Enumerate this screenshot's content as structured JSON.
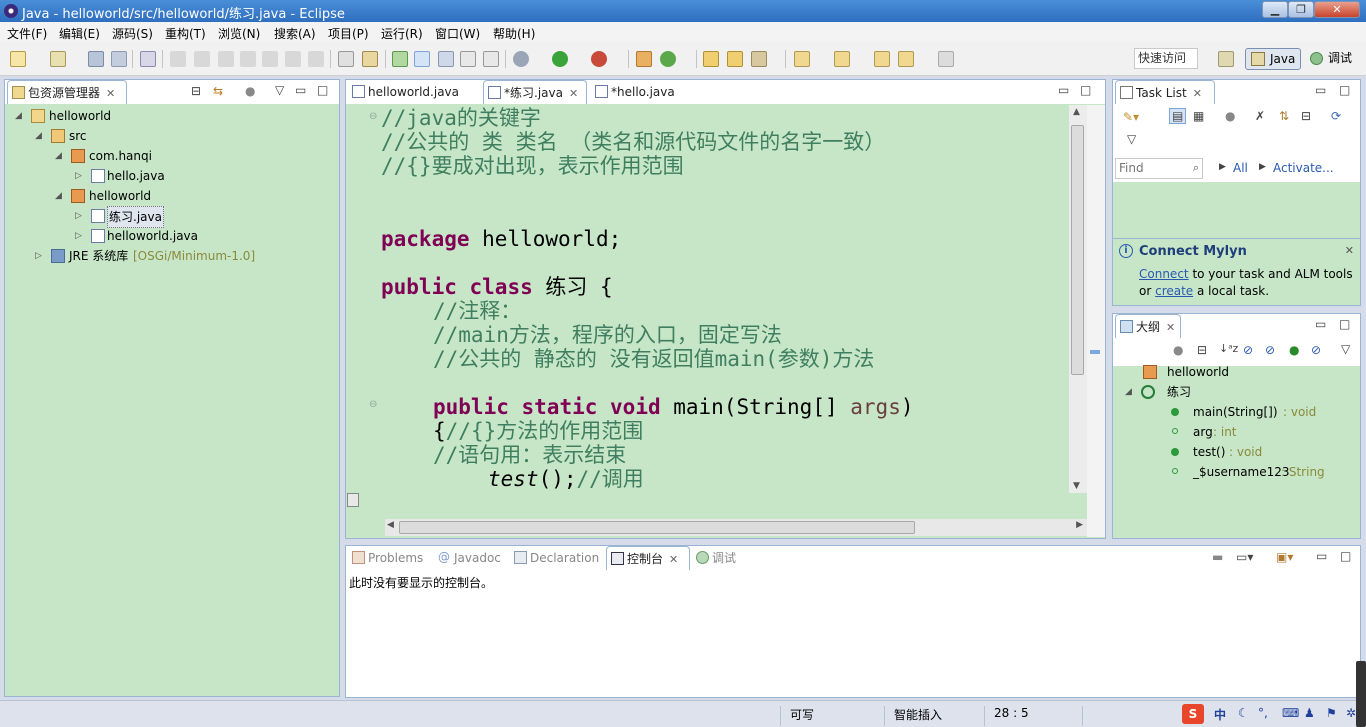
{
  "window": {
    "title": "Java - helloworld/src/helloworld/练习.java - Eclipse",
    "min": "▁",
    "max": "❐",
    "close": "✕"
  },
  "menu": [
    "文件(F)",
    "编辑(E)",
    "源码(S)",
    "重构(T)",
    "浏览(N)",
    "搜索(A)",
    "项目(P)",
    "运行(R)",
    "窗口(W)",
    "帮助(H)"
  ],
  "toolbar": {
    "quick_access": "快速访问",
    "perspective_java": "Java",
    "perspective_debug": "调试"
  },
  "package_explorer": {
    "title": "包资源管理器",
    "tree": [
      {
        "label": "helloworld",
        "icon": "project-icon"
      },
      {
        "label": "src",
        "icon": "source-folder-icon"
      },
      {
        "label": "com.hanqi",
        "icon": "package-icon"
      },
      {
        "label": "hello.java",
        "icon": "java-file-icon"
      },
      {
        "label": "helloworld",
        "icon": "package-icon"
      },
      {
        "label": "练习.java",
        "icon": "java-file-icon"
      },
      {
        "label": "helloworld.java",
        "icon": "java-file-icon"
      },
      {
        "label": "JRE 系统库",
        "suffix": "[OSGi/Minimum-1.0]",
        "icon": "library-icon"
      }
    ]
  },
  "editor": {
    "tabs": [
      {
        "label": "helloworld.java"
      },
      {
        "label": "*练习.java"
      },
      {
        "label": "*hello.java"
      }
    ],
    "lines": {
      "l1": "//java的关键字",
      "l2": "//公共的 类 类名 （类名和源代码文件的名字一致）",
      "l3": "//{}要成对出现，表示作用范围",
      "l4_kw": "package",
      "l4_rest": " helloworld;",
      "l5_kw1": "public",
      "l5_kw2": "class",
      "l5_rest": " 练习 {",
      "l6": "//注释：",
      "l7": "//main方法，程序的入口，固定写法",
      "l8": "//公共的 静态的 没有返回值main(参数)方法",
      "l9_kw1": "public",
      "l9_kw2": "static",
      "l9_kw3": "void",
      "l9_mid": " main(String[] ",
      "l9_param": "args",
      "l9_end": ")",
      "l10_brace": "{",
      "l10_comment": "//{}方法的作用范围",
      "l11": "//语句用：表示结束",
      "l12_call": "test",
      "l12_rest": "();",
      "l12_comment": "//调用"
    }
  },
  "task_list": {
    "title": "Task List",
    "find_placeholder": "Find",
    "all": "All",
    "activate": "Activate..."
  },
  "mylyn": {
    "title": "Connect Mylyn",
    "connect": "Connect",
    "text1": " to your task and ALM tools",
    "or": "or ",
    "create": "create",
    "text2": " a local task."
  },
  "outline": {
    "title": "大纲",
    "items": [
      {
        "label": "helloworld",
        "type": ""
      },
      {
        "label": "练习",
        "type": ""
      },
      {
        "label": "main(String[])",
        "type": " : void"
      },
      {
        "label": "arg",
        "type": " : int"
      },
      {
        "label": "test()",
        "type": " : void"
      },
      {
        "label": "_$username123",
        "type": " : String"
      }
    ]
  },
  "bottom": {
    "tabs": [
      {
        "label": "Problems"
      },
      {
        "label": "Javadoc"
      },
      {
        "label": "Declaration"
      },
      {
        "label": "控制台"
      },
      {
        "label": "调试"
      }
    ],
    "console_message": "此时没有要显示的控制台。"
  },
  "status": {
    "writable": "可写",
    "insert_mode": "智能插入",
    "position": "28 : 5",
    "ime": "中"
  },
  "colors": {
    "panel_bg": "#c7e6c8",
    "keyword": "#7f0055",
    "comment": "#3f7f5f",
    "title_bar": "#2e6fbf"
  }
}
